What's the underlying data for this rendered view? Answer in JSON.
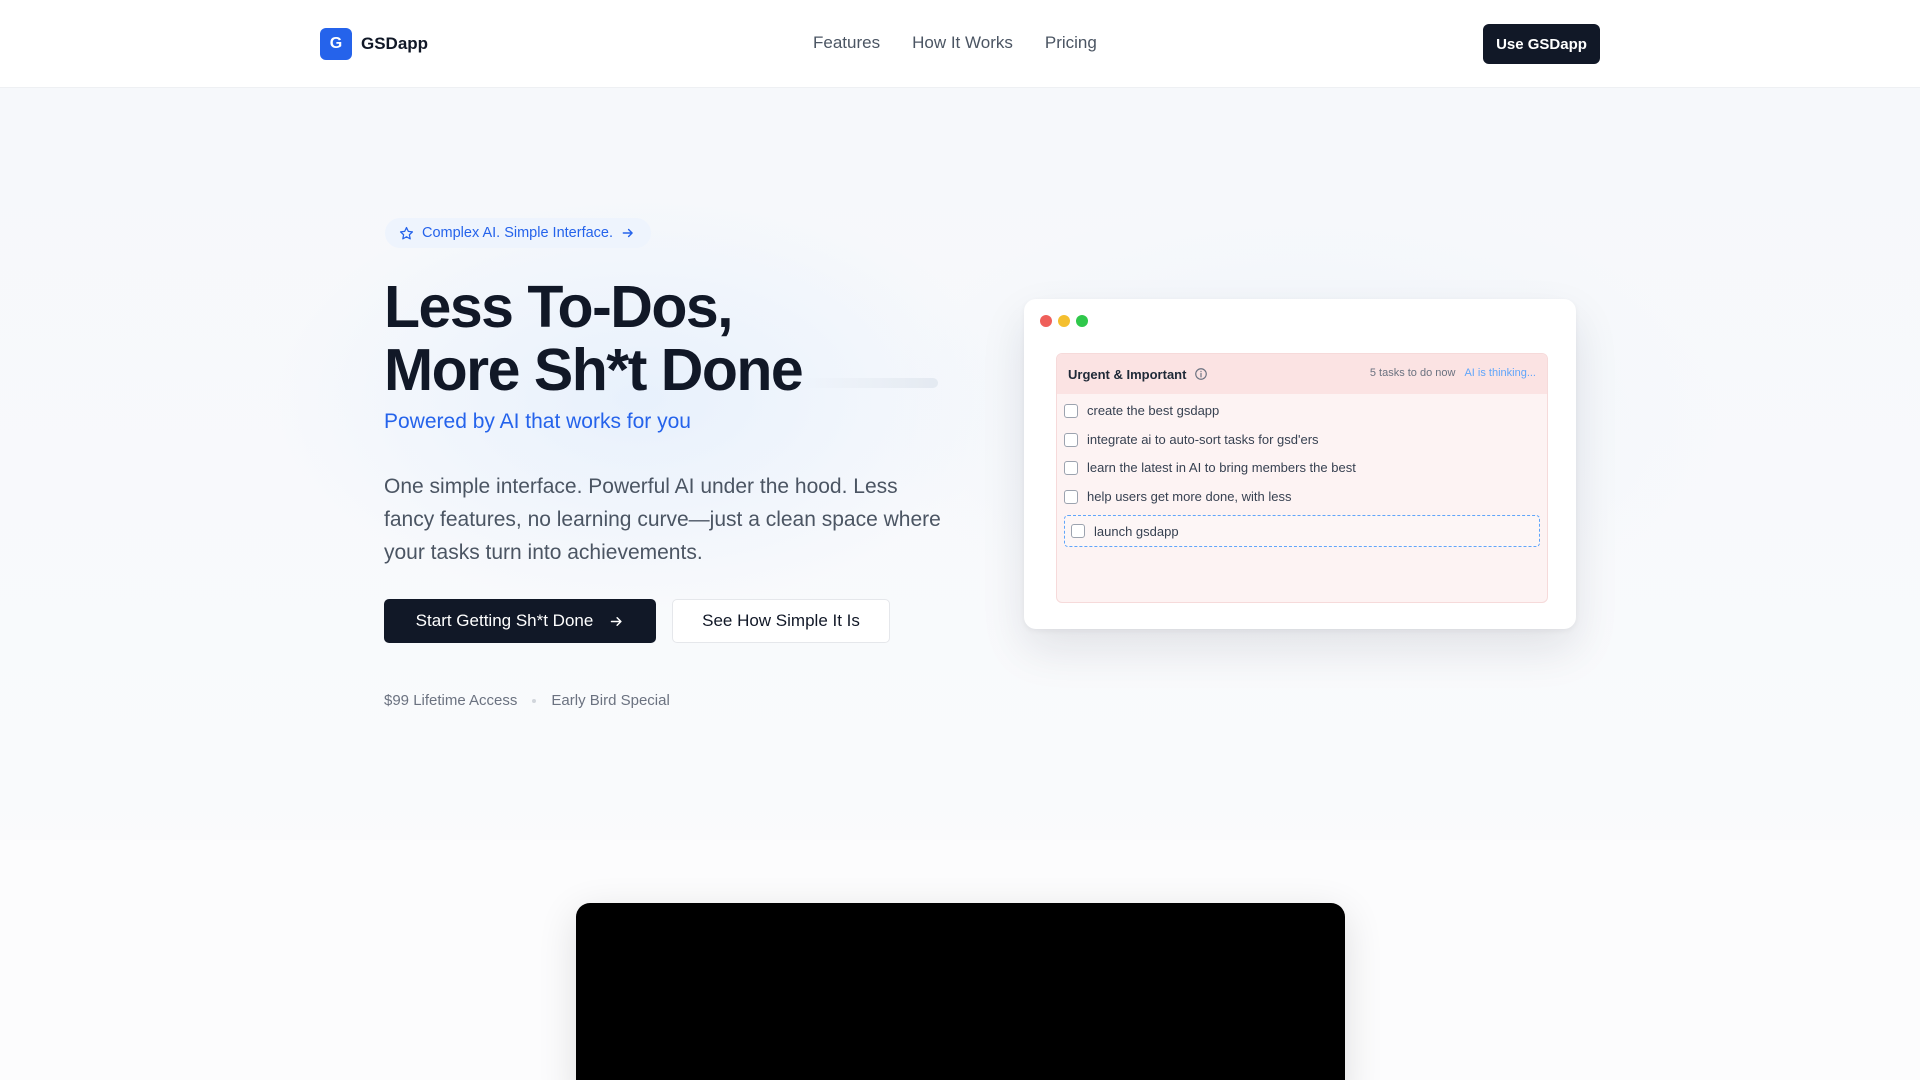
{
  "nav": {
    "logo_letter": "G",
    "brand": "GSDapp",
    "links": [
      "Features",
      "How It Works",
      "Pricing"
    ],
    "cta": "Use GSDapp"
  },
  "hero": {
    "badge": "Complex AI. Simple Interface.",
    "headline_line1": "Less To-Dos,",
    "headline_line2": "More Sh*t Done",
    "subhead": "Powered by AI that works for you",
    "description": "One simple interface. Powerful AI under the hood. Less fancy features, no learning curve—just a clean space where your tasks turn into achievements.",
    "primary_button": "Start Getting Sh*t Done",
    "secondary_button": "See How Simple It Is",
    "price_note": "$99 Lifetime Access",
    "offer_note": "Early Bird Special"
  },
  "mockup": {
    "panel_title": "Urgent & Important",
    "task_count": "5 tasks to do now",
    "ai_status": "AI is thinking...",
    "tasks": [
      "create the best gsdapp",
      "integrate ai to auto-sort tasks for gsd'ers",
      "learn the latest in AI to bring members the best",
      "help users get more done, with less"
    ],
    "new_task": "launch gsdapp"
  },
  "colors": {
    "accent": "#2563eb",
    "dark": "#111827",
    "panel_bg": "#fdf3f3",
    "traffic_red": "#ef5f5a",
    "traffic_yellow": "#f4bf2f",
    "traffic_green": "#2fc84b"
  },
  "icons": {
    "badge": "star-icon",
    "badge_arrow": "arrow-right-icon",
    "button_arrow": "arrow-right-icon",
    "info": "info-icon"
  }
}
